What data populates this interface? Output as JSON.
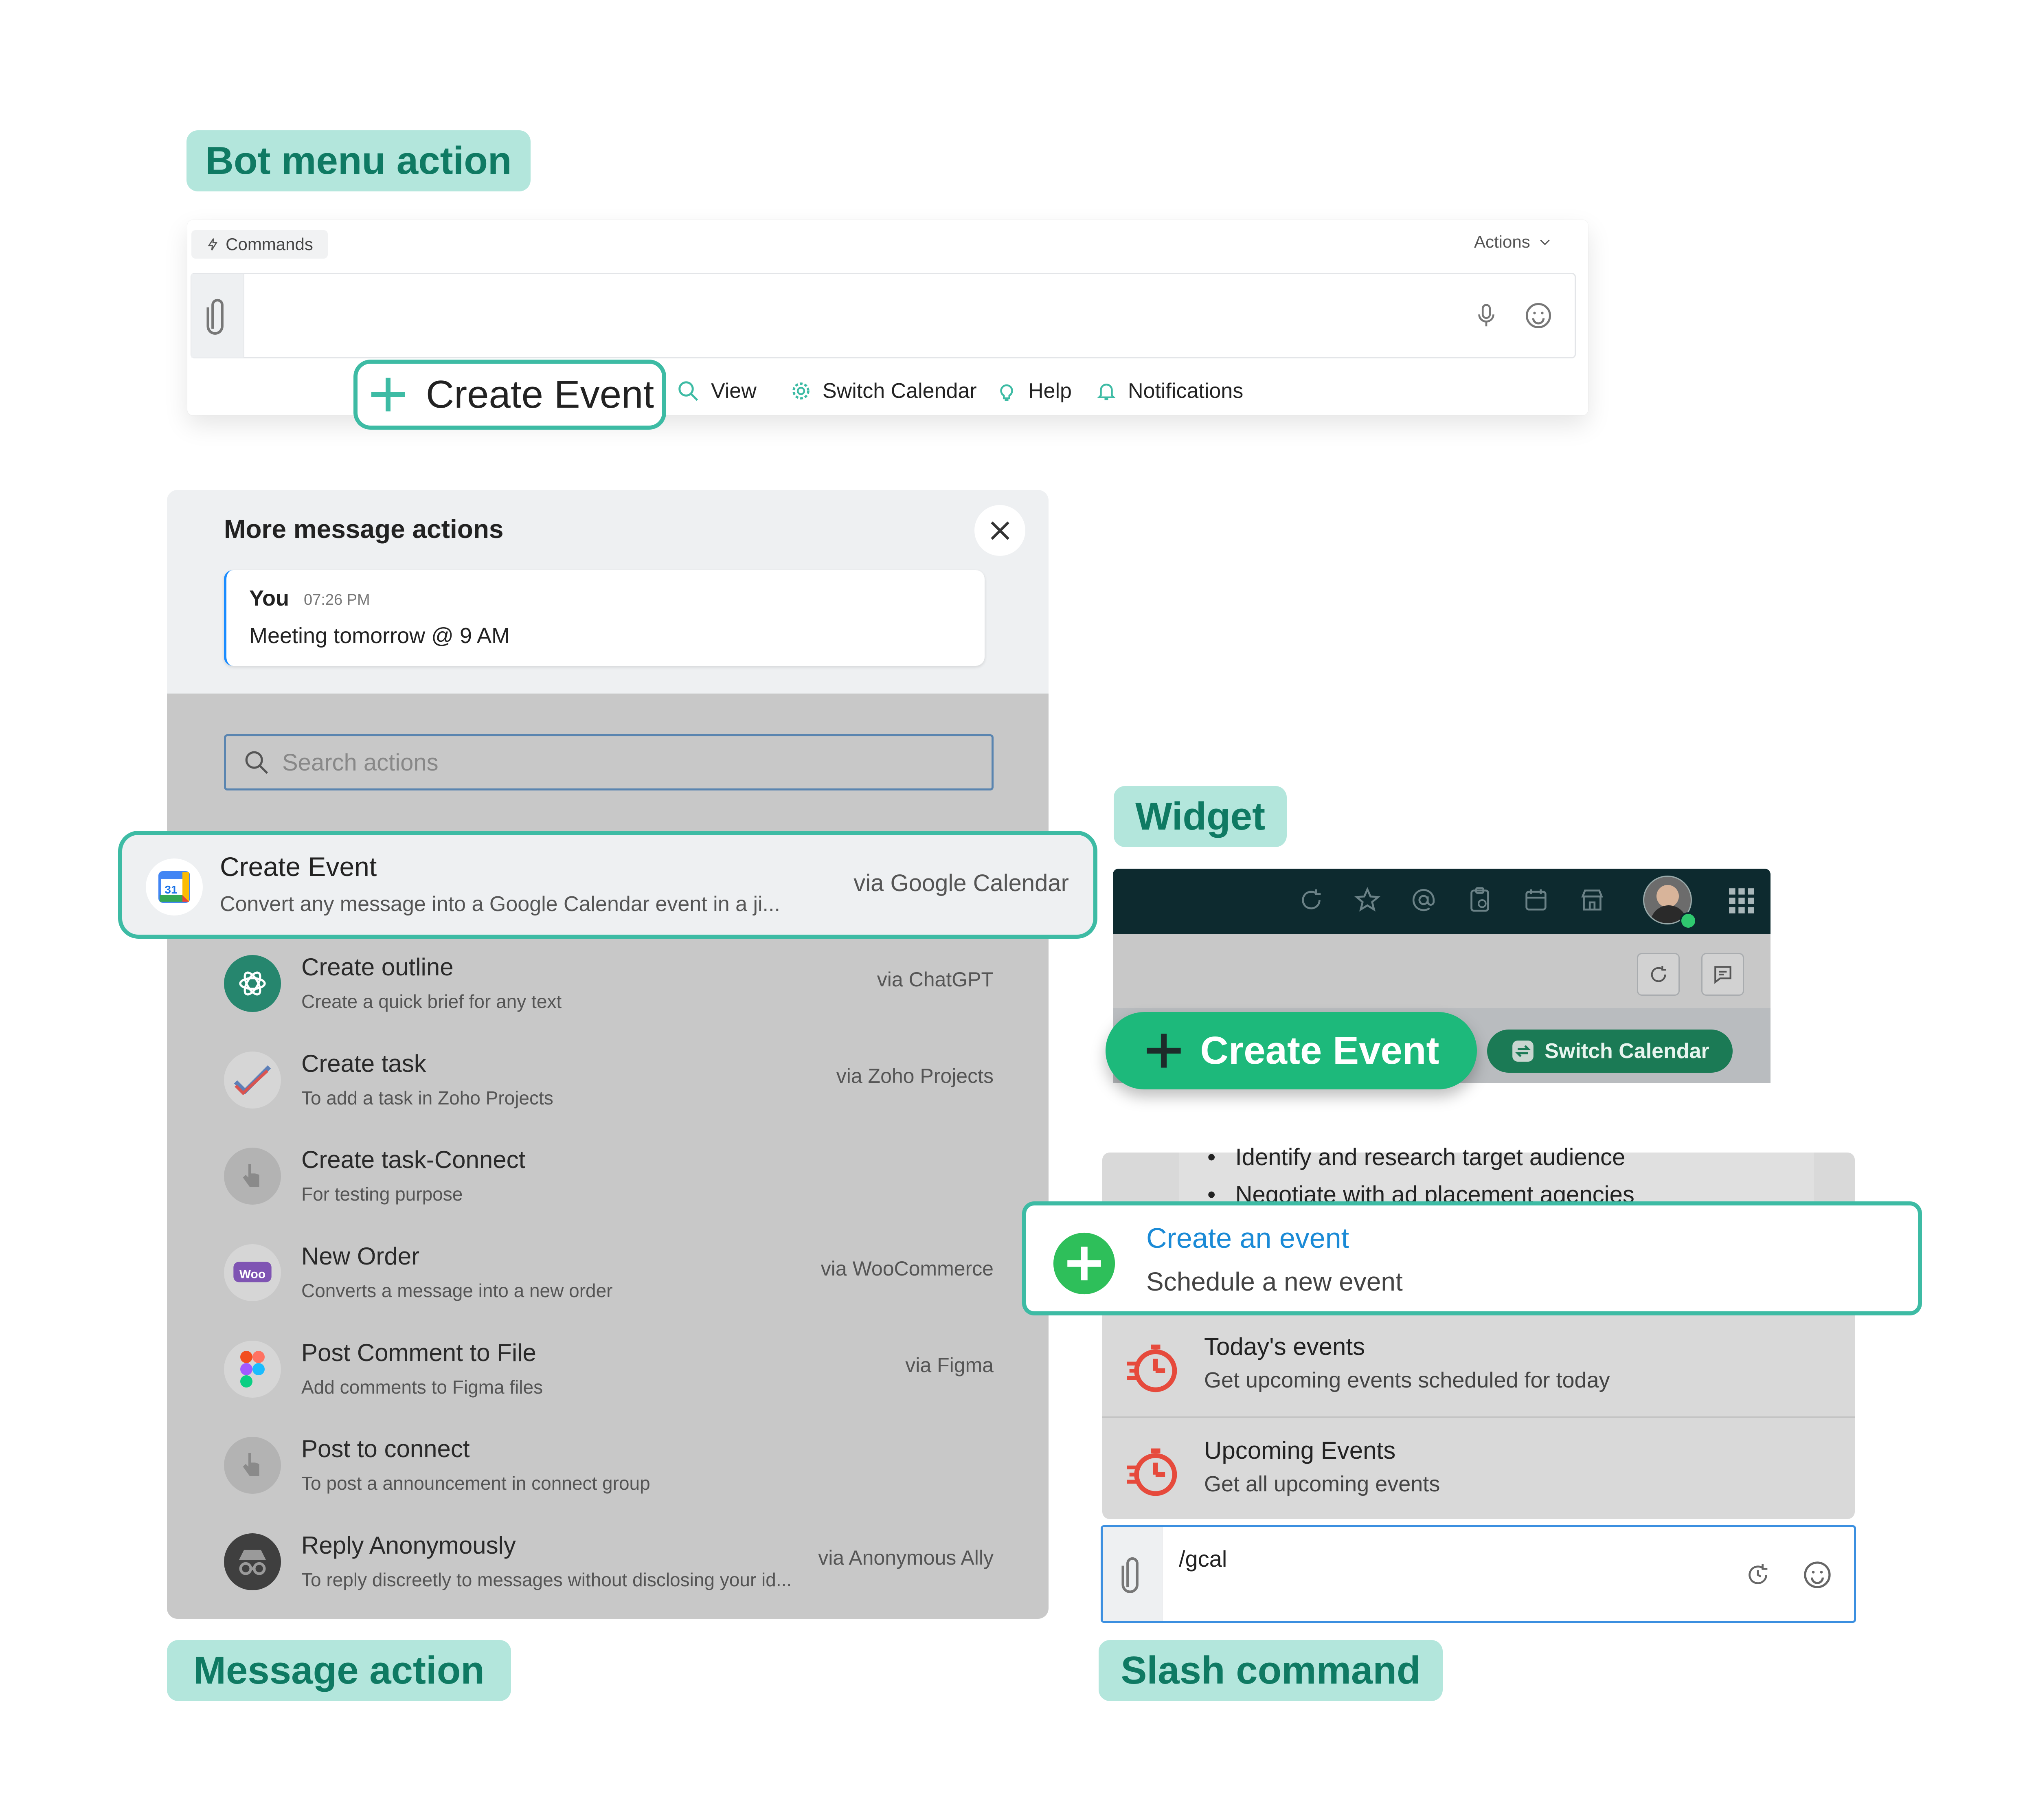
{
  "labels": {
    "bot_menu": "Bot menu action",
    "widget": "Widget",
    "message_action": "Message action",
    "slash_command": "Slash command"
  },
  "bot_menu": {
    "commands_label": "Commands",
    "actions_label": "Actions",
    "items": [
      {
        "label": "Create Event",
        "icon": "plus-icon"
      },
      {
        "label": "View",
        "icon": "search-icon"
      },
      {
        "label": "Switch Calendar",
        "icon": "gear-icon"
      },
      {
        "label": "Help",
        "icon": "bulb-icon"
      },
      {
        "label": "Notifications",
        "icon": "bell-icon"
      }
    ]
  },
  "message_actions": {
    "title": "More message actions",
    "message": {
      "author": "You",
      "time": "07:26 PM",
      "text": "Meeting tomorrow @ 9 AM"
    },
    "search_placeholder": "Search actions",
    "items": [
      {
        "title": "Create Event",
        "subtitle": "Convert any message into a Google Calendar event in a ji...",
        "via": "via Google Calendar",
        "icon": "google-calendar-icon"
      },
      {
        "title": "Create outline",
        "subtitle": "Create a quick brief for any text",
        "via": "via ChatGPT",
        "icon": "chatgpt-icon"
      },
      {
        "title": "Create task",
        "subtitle": "To add a task in Zoho Projects",
        "via": "via Zoho Projects",
        "icon": "zoho-projects-icon"
      },
      {
        "title": "Create task-Connect",
        "subtitle": "For testing purpose",
        "via": "",
        "icon": "pointer-icon"
      },
      {
        "title": "New Order",
        "subtitle": "Converts a message into a new order",
        "via": "via WooCommerce",
        "icon": "woocommerce-icon"
      },
      {
        "title": "Post Comment to File",
        "subtitle": "Add comments to Figma files",
        "via": "via Figma",
        "icon": "figma-icon"
      },
      {
        "title": "Post to connect",
        "subtitle": "To post a announcement in connect group",
        "via": "",
        "icon": "pointer-icon"
      },
      {
        "title": "Reply Anonymously",
        "subtitle": "To reply discreetly to messages without disclosing your id...",
        "via": "via Anonymous Ally",
        "icon": "incognito-icon"
      }
    ]
  },
  "widget": {
    "toolbar_icons": [
      "history-icon",
      "star-icon",
      "at-icon",
      "clipboard-icon",
      "calendar-icon",
      "store-icon",
      "avatar",
      "apps-grid-icon"
    ],
    "create_label": "Create Event",
    "switch_label": "Switch Calendar"
  },
  "slash": {
    "bullets": [
      "Identify and research target audience",
      "Negotiate with ad placement agencies"
    ],
    "items": [
      {
        "title": "Create an event",
        "subtitle": "Schedule a new event",
        "icon": "plus-circle-icon"
      },
      {
        "title": "Today's events",
        "subtitle": "Get upcoming events scheduled for today",
        "icon": "timer-icon"
      },
      {
        "title": "Upcoming Events",
        "subtitle": "Get all upcoming events",
        "icon": "timer-icon"
      }
    ],
    "input_value": "/gcal"
  },
  "colors": {
    "accent": "#3dbba4",
    "tag_bg": "#b3e6dc",
    "tag_text": "#0f7a63",
    "widget_green": "#1db97b",
    "link_blue": "#1a8ad6"
  }
}
